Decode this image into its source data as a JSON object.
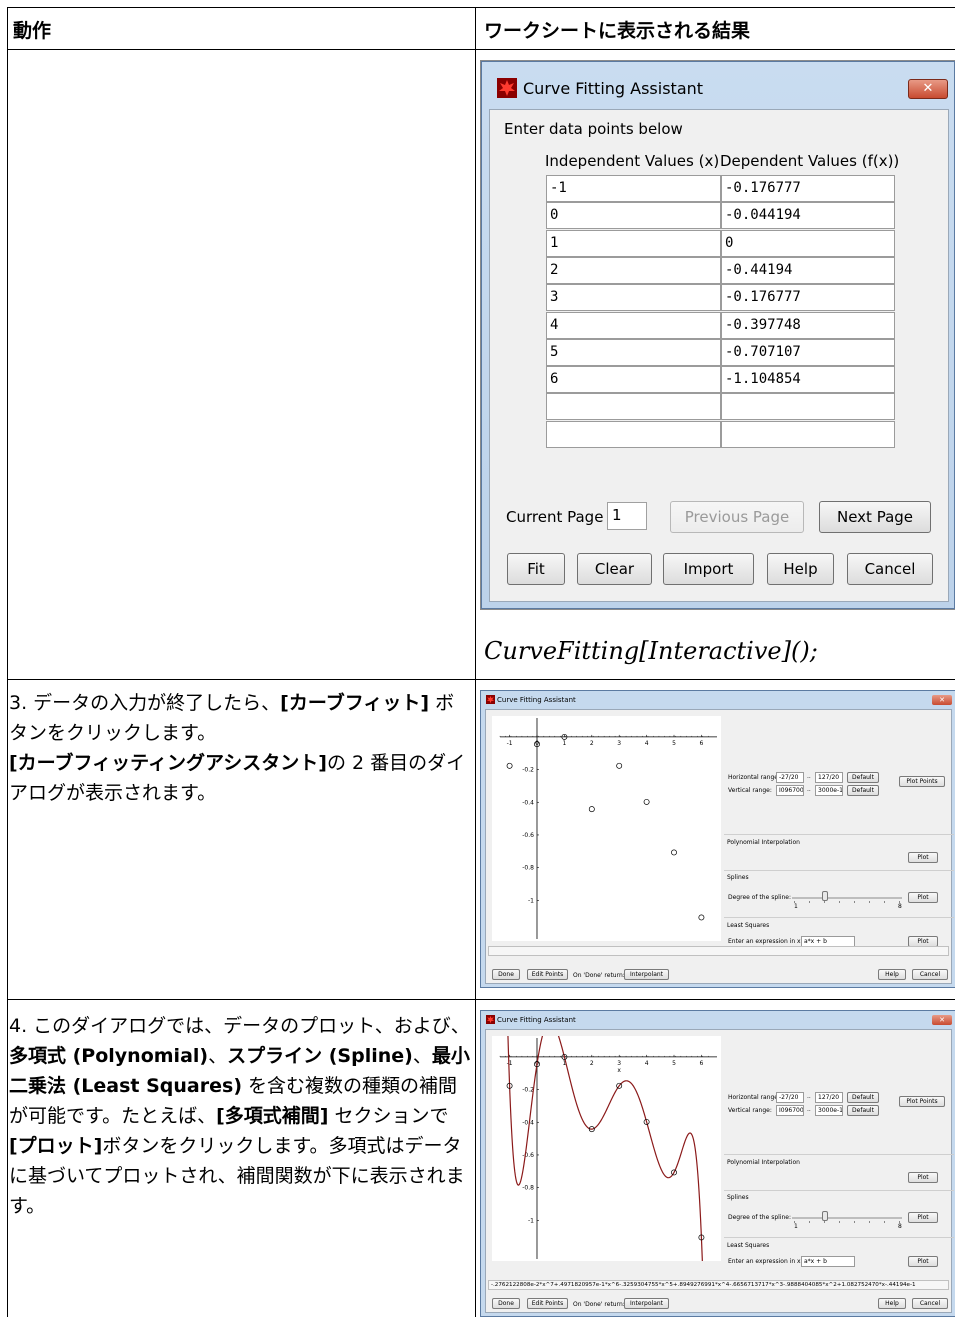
{
  "doc": {
    "header_action": "動作",
    "header_result": "ワークシートに表示される結果",
    "command": "CurveFitting[Interactive]();",
    "step3_parts": [
      "3. データの入力が終了したら、",
      "[カーブフィット]",
      " ボタンをクリックします。",
      "[カーブフィッティングアシスタント]",
      "の 2 番目のダイアログが表示されます。"
    ],
    "step4_parts": [
      "4. このダイアログでは、データのプロット、および、",
      "多項式 (Polynomial)",
      "、",
      "スプライン (Spline)",
      "、",
      "最小二乗法 (Least Squares)",
      " を含む複数の種類の補間が可能です。たとえば、",
      "[多項式補間]",
      " セクションで",
      "[プロット]",
      "ボタンをクリックします。多項式はデータに基づいてプロットされ、補間関数が下に表示されます。"
    ]
  },
  "dialog1": {
    "title": "Curve Fitting Assistant",
    "close_label": "✕",
    "prompt": "Enter data points below",
    "col_x": "Independent Values (x)",
    "col_fx": "Dependent Values (f(x))",
    "rows": [
      {
        "x": "-1",
        "fx": "-0.176777"
      },
      {
        "x": "0",
        "fx": "-0.044194"
      },
      {
        "x": "1",
        "fx": "0"
      },
      {
        "x": "2",
        "fx": "-0.44194"
      },
      {
        "x": "3",
        "fx": "-0.176777"
      },
      {
        "x": "4",
        "fx": "-0.397748"
      },
      {
        "x": "5",
        "fx": "-0.707107"
      },
      {
        "x": "6",
        "fx": "-1.104854"
      },
      {
        "x": "",
        "fx": ""
      },
      {
        "x": "",
        "fx": ""
      }
    ],
    "current_page_label": "Current Page",
    "current_page": "1",
    "prev_page": "Previous Page",
    "next_page": "Next Page",
    "btn_fit": "Fit",
    "btn_clear": "Clear",
    "btn_import": "Import",
    "btn_help": "Help",
    "btn_cancel": "Cancel"
  },
  "dialog2": {
    "title": "Curve Fitting Assistant",
    "close_label": "✕",
    "horizontal_label": "Horizontal range:",
    "h_min": "-27/20",
    "h_max": "127/20",
    "vertical_label": "Vertical range:",
    "v_min": "I096700",
    "v_max": "3000e-1",
    "dots": "..",
    "default_label": "Default",
    "plot_points": "Plot Points",
    "poly_section": "Polynomial Interpolation",
    "plot_label": "Plot",
    "splines_section": "Splines",
    "degree_label": "Degree of the spline:",
    "slider_min": "1",
    "slider_max": "8",
    "least_squares_section": "Least Squares",
    "expr_label": "Enter an expression in x:",
    "expr_value": "a*x + b",
    "done": "Done",
    "edit_points": "Edit Points",
    "on_done_label": "On 'Done' return:",
    "on_done_value": "Interpolant",
    "help": "Help",
    "cancel": "Cancel",
    "result_expr": "-.2762122808e-2*x^7+.4971820957e-1*x^6-.3259304755*x^5+.8949276991*x^4-.6656713717*x^3-.9888404085*x^2+1.082752470*x-.44194e-1",
    "x_axis_label": "x"
  },
  "chart_data": {
    "type": "scatter",
    "x": [
      -1,
      0,
      1,
      2,
      3,
      4,
      5,
      6
    ],
    "y": [
      -0.176777,
      -0.044194,
      0,
      -0.44194,
      -0.176777,
      -0.397748,
      -0.707107,
      -1.104854
    ],
    "xlim": [
      -1.35,
      6.35
    ],
    "ylim": [
      -1.2,
      0.03
    ],
    "x_ticks": [
      "-1",
      "0",
      "1",
      "2",
      "3",
      "4",
      "5",
      "6"
    ],
    "y_ticks": [
      "-0.2",
      "-0.4",
      "-0.6",
      "-0.8",
      "-1"
    ],
    "y_tick_values": [
      -0.2,
      -0.4,
      -0.6,
      -0.8,
      -1
    ],
    "poly_coeffs": [
      -0.002762122808,
      0.04971820957,
      -0.3259304755,
      0.8949276991,
      -0.6656713717,
      -0.9888404085,
      1.08275247,
      -0.044194
    ],
    "line_color": "#8b1a1a"
  },
  "colors": {
    "accent": "#c84b31",
    "curve": "#8b1a1a"
  }
}
